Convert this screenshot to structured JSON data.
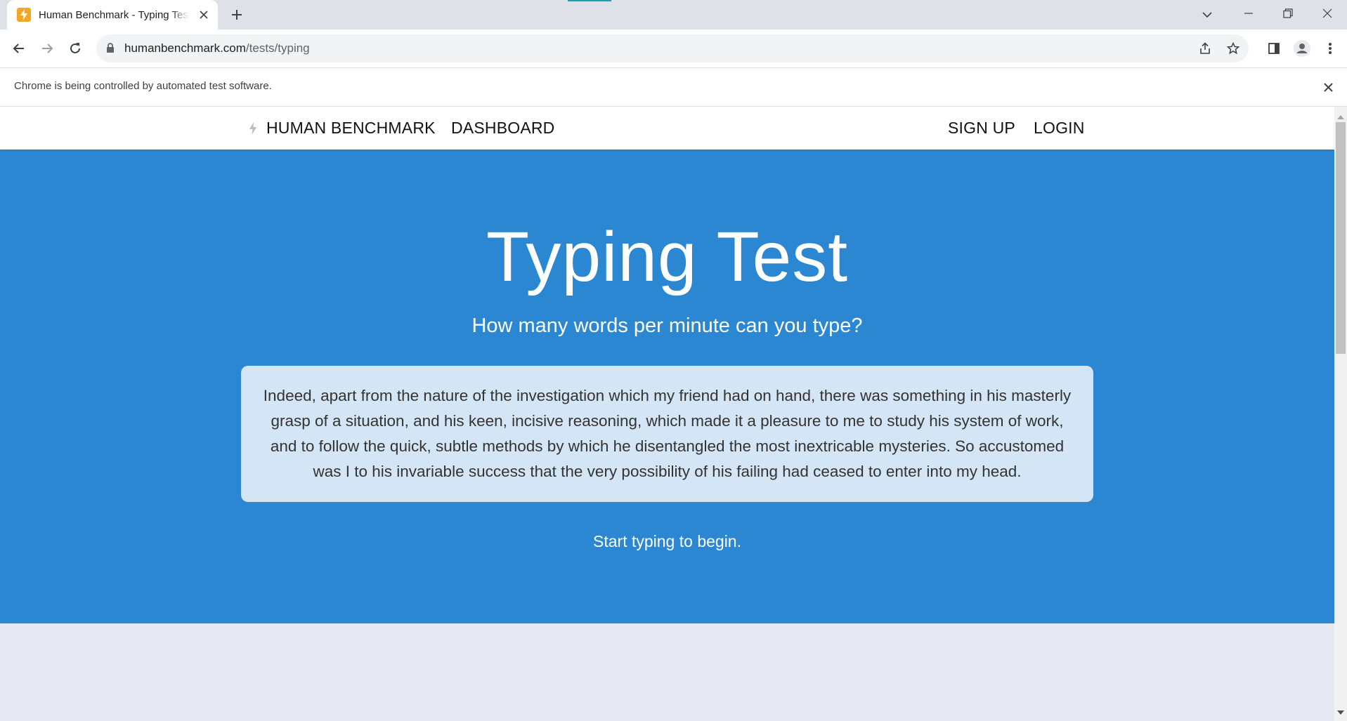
{
  "browser": {
    "tab": {
      "title": "Human Benchmark - Typing Test",
      "favicon": "bolt-icon"
    },
    "address": {
      "domain": "humanbenchmark.com",
      "path": "/tests/typing"
    },
    "infobar": {
      "message": "Chrome is being controlled by automated test software."
    },
    "colors": {
      "tabstrip": "#dee1e6",
      "omnibox": "#f1f3f4",
      "favicon": "#f5a623"
    }
  },
  "site": {
    "nav": {
      "brand": "HUMAN BENCHMARK",
      "dashboard": "DASHBOARD",
      "signup": "SIGN UP",
      "login": "LOGIN"
    },
    "hero": {
      "title": "Typing Test",
      "subtitle": "How many words per minute can you type?",
      "passage": "Indeed, apart from the nature of the investigation which my friend had on hand, there was something in his masterly grasp of a situation, and his keen, incisive reasoning, which made it a pleasure to me to study his system of work, and to follow the quick, subtle methods by which he disentangled the most inextricable mysteries. So accustomed was I to his invariable success that the very possibility of his failing had ceased to enter into my head.",
      "prompt": "Start typing to begin."
    },
    "colors": {
      "hero": "#2b87d1",
      "passage_bg": "#d4e5f5",
      "page_bg": "#e6e8f4"
    }
  }
}
